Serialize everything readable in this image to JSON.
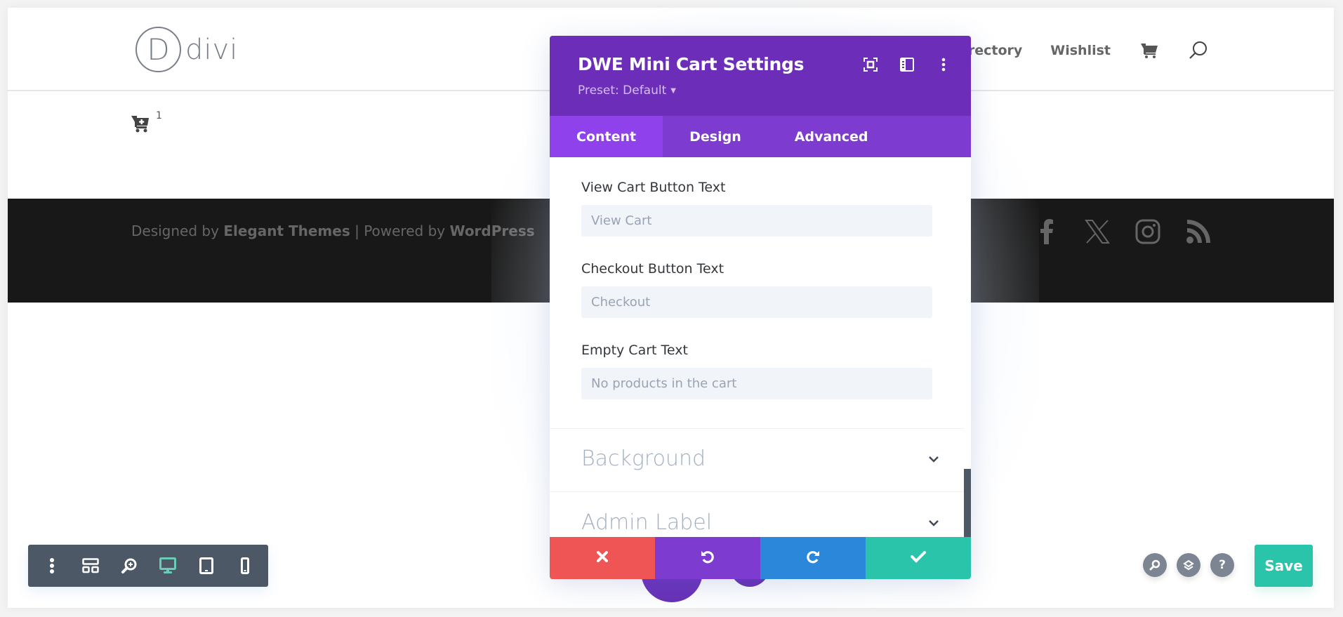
{
  "site": {
    "logo_letter": "D",
    "logo_text": "divi",
    "nav": {
      "items": [
        {
          "label": "Directory"
        },
        {
          "label": "Wishlist"
        }
      ],
      "cart_icon": "shopping-cart-icon",
      "search_icon": "search-icon"
    },
    "mini_cart": {
      "icon": "cart-plus-icon",
      "count": "1"
    },
    "footer": {
      "designed_by_prefix": "Designed by ",
      "designed_by_name": "Elegant Themes",
      "separator": " | Powered by ",
      "powered_by_name": "WordPress",
      "social": [
        "facebook-icon",
        "x-twitter-icon",
        "instagram-icon",
        "rss-icon"
      ]
    }
  },
  "modal": {
    "title": "DWE Mini Cart Settings",
    "preset_label": "Preset: Default",
    "header_icons": [
      "fullscreen-icon",
      "split-view-icon",
      "more-options-icon"
    ],
    "tabs": [
      {
        "label": "Content",
        "active": true
      },
      {
        "label": "Design",
        "active": false
      },
      {
        "label": "Advanced",
        "active": false
      }
    ],
    "fields": [
      {
        "label": "View Cart Button Text",
        "value": "",
        "placeholder": "View Cart"
      },
      {
        "label": "Checkout Button Text",
        "value": "",
        "placeholder": "Checkout"
      },
      {
        "label": "Empty Cart Text",
        "value": "",
        "placeholder": "No products in the cart"
      }
    ],
    "sections": [
      {
        "title": "Background",
        "expanded": false
      },
      {
        "title": "Admin Label",
        "expanded": false
      }
    ],
    "footer_actions": [
      "discard",
      "undo",
      "redo",
      "save-changes"
    ]
  },
  "builder": {
    "toolbar": [
      "menu",
      "wireframe",
      "zoom",
      "desktop",
      "tablet",
      "phone"
    ],
    "active_view": "desktop",
    "quick_actions": [
      "find",
      "layers",
      "help"
    ],
    "help_label": "?",
    "save_label": "Save"
  },
  "colors": {
    "modal_header": "#6c2eb9",
    "tab_bar": "#7e3bd0",
    "tab_active": "#8f42ec",
    "discard": "#ef5555",
    "undo": "#7e3bd0",
    "redo": "#2b87da",
    "confirm": "#29c4a9",
    "toolbar": "#4c5866",
    "active_view": "#6ccab6",
    "footer_bg": "#181818"
  }
}
